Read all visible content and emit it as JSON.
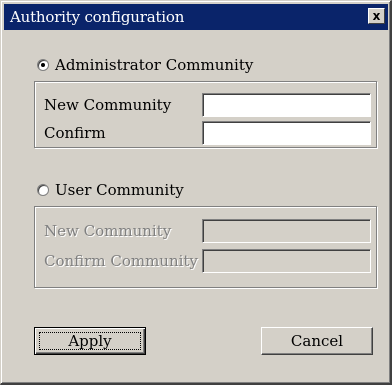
{
  "window": {
    "title": "Authority configuration",
    "close_glyph": "x",
    "titlebar_color": "#0a246a",
    "face_color": "#d4d0c8"
  },
  "admin": {
    "label": "Administrator Community",
    "selected": true,
    "new_label": "New Community",
    "new_value": "",
    "confirm_label": "Confirm",
    "confirm_value": ""
  },
  "user": {
    "label": "User Community",
    "selected": false,
    "new_label": "New Community",
    "new_value": "",
    "confirm_label": "Confirm Community",
    "confirm_value": ""
  },
  "buttons": {
    "apply_label": "Apply",
    "cancel_label": "Cancel"
  }
}
